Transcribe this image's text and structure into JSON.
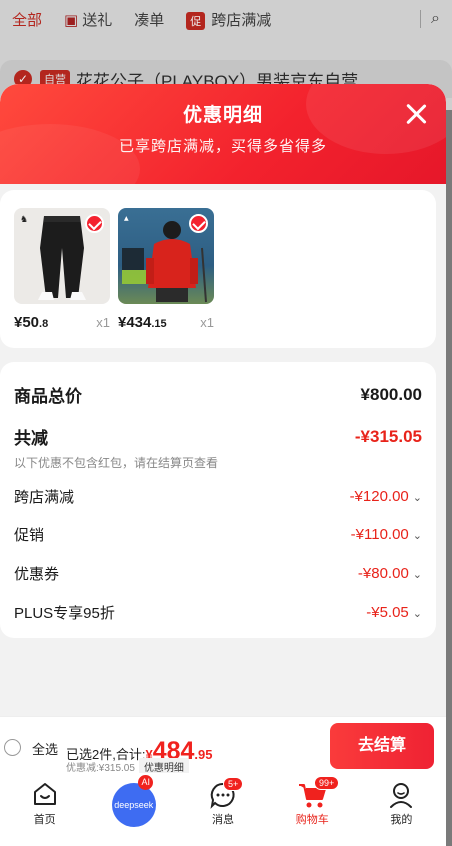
{
  "background": {
    "tabs": [
      {
        "label": "全部",
        "active": true
      },
      {
        "label": "送礼",
        "active": false
      },
      {
        "label": "凑单",
        "active": false
      },
      {
        "label": "跨店满减",
        "tag": "促",
        "active": false
      }
    ],
    "product_tag": "自营",
    "product_title": "花花公子（PLAYBOY）男装京东自营..."
  },
  "sheet": {
    "title": "优惠明细",
    "subtitle": "已享跨店满减，买得多省得多"
  },
  "products": [
    {
      "price_int": "¥50",
      "price_dec": ".8",
      "qty": "x1",
      "image": "black-track-pants"
    },
    {
      "price_int": "¥434",
      "price_dec": ".15",
      "qty": "x1",
      "image": "red-hooded-jacket"
    }
  ],
  "summary": {
    "total_label": "商品总价",
    "total_value": "¥800.00",
    "reduce_label": "共减",
    "reduce_value": "-¥315.05",
    "note": "以下优惠不包含红包，请在结算页查看",
    "items": [
      {
        "label": "跨店满减",
        "value": "-¥120.00"
      },
      {
        "label": "促销",
        "value": "-¥110.00"
      },
      {
        "label": "优惠券",
        "value": "-¥80.00"
      },
      {
        "label": "PLUS专享95折",
        "value": "-¥5.05"
      }
    ]
  },
  "checkout": {
    "select_all": "全选",
    "selected_text": "已选2件,合计:",
    "currency": "¥",
    "total_int": "484",
    "total_dec": ".95",
    "discount_text": "优惠减:¥315.05",
    "detail_label": "优惠明细",
    "button_label": "去结算"
  },
  "tabbar": {
    "items": [
      {
        "label": "首页",
        "icon": "home-icon"
      },
      {
        "label": "",
        "icon": "deepseek-icon",
        "text": "deepseek",
        "badge": "AI"
      },
      {
        "label": "消息",
        "icon": "message-icon",
        "badge": "5+"
      },
      {
        "label": "购物车",
        "icon": "cart-icon",
        "badge": "99+",
        "active": true
      },
      {
        "label": "我的",
        "icon": "profile-icon"
      }
    ]
  },
  "colors": {
    "accent": "#f0221e",
    "header": "#f3222d"
  }
}
